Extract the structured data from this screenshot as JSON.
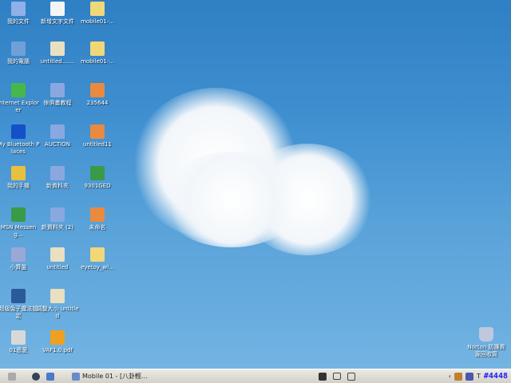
{
  "desktop_icons": [
    {
      "label": "我的文件",
      "icon": "my-documents-icon",
      "color": "#8fb0e8"
    },
    {
      "label": "新增文字文件",
      "icon": "text-file-icon",
      "color": "#f4f4f4"
    },
    {
      "label": "mobile01-...",
      "icon": "zip-folder-icon",
      "color": "#f0d878"
    },
    {
      "label": "我的電腦",
      "icon": "my-computer-icon",
      "color": "#6fa0d8"
    },
    {
      "label": "untitled.......",
      "icon": "image-file-icon",
      "color": "#e8e0c0"
    },
    {
      "label": "mobile01-...",
      "icon": "zip-folder-icon",
      "color": "#f0d878"
    },
    {
      "label": "Internet Explorer",
      "icon": "internet-explorer-icon",
      "color": "#46b84a"
    },
    {
      "label": "傢俱畫教程",
      "icon": "folder-icon",
      "color": "#8aa8e0"
    },
    {
      "label": "235644",
      "icon": "photo-file-icon",
      "color": "#e88a40"
    },
    {
      "label": "My Bluetooth Places",
      "icon": "bluetooth-icon",
      "color": "#1550c8"
    },
    {
      "label": "AUCTION",
      "icon": "folder-icon",
      "color": "#8aa8e0"
    },
    {
      "label": "untitled11",
      "icon": "photo-file-icon",
      "color": "#e88a40"
    },
    {
      "label": "我的手機",
      "icon": "my-phone-icon",
      "color": "#e8c040"
    },
    {
      "label": "新資料夾",
      "icon": "folder-icon",
      "color": "#8aa8e0"
    },
    {
      "label": "9301GED",
      "icon": "excel-file-icon",
      "color": "#3a9a48"
    },
    {
      "label": "MSN Messeng...",
      "icon": "msn-messenger-icon",
      "color": "#3a9a48"
    },
    {
      "label": "新資料夾 (2)",
      "icon": "folder-icon",
      "color": "#8aa8e0"
    },
    {
      "label": "未命名",
      "icon": "photo-file-icon",
      "color": "#e88a40"
    },
    {
      "label": "小算盤",
      "icon": "calculator-icon",
      "color": "#9aa8d8"
    },
    {
      "label": "untitled",
      "icon": "image-file-icon",
      "color": "#e8e0c0"
    },
    {
      "label": "eyetoy_wi...",
      "icon": "zip-folder-icon",
      "color": "#f0d878"
    },
    {
      "label": "超級兔子魔法設定",
      "icon": "super-rabbit-icon",
      "color": "#2a5a9a"
    },
    {
      "label": "調整大小 untitled",
      "icon": "image-file-icon",
      "color": "#e8e0c0"
    },
    null,
    {
      "label": "01恩愛",
      "icon": "app-icon",
      "color": "#d8d8d8"
    },
    {
      "label": "VAF1.0.pdf",
      "icon": "media-player-icon",
      "color": "#f0a020"
    }
  ],
  "recycle_bin": {
    "label": "Norton 防護資源回收筒",
    "icon": "recycle-bin-icon",
    "color": "#c0c8e0"
  },
  "taskbar": {
    "task_label": "Mobile 01 - [八卦輕...",
    "clock": "#4448",
    "clock_prefix": "T"
  }
}
